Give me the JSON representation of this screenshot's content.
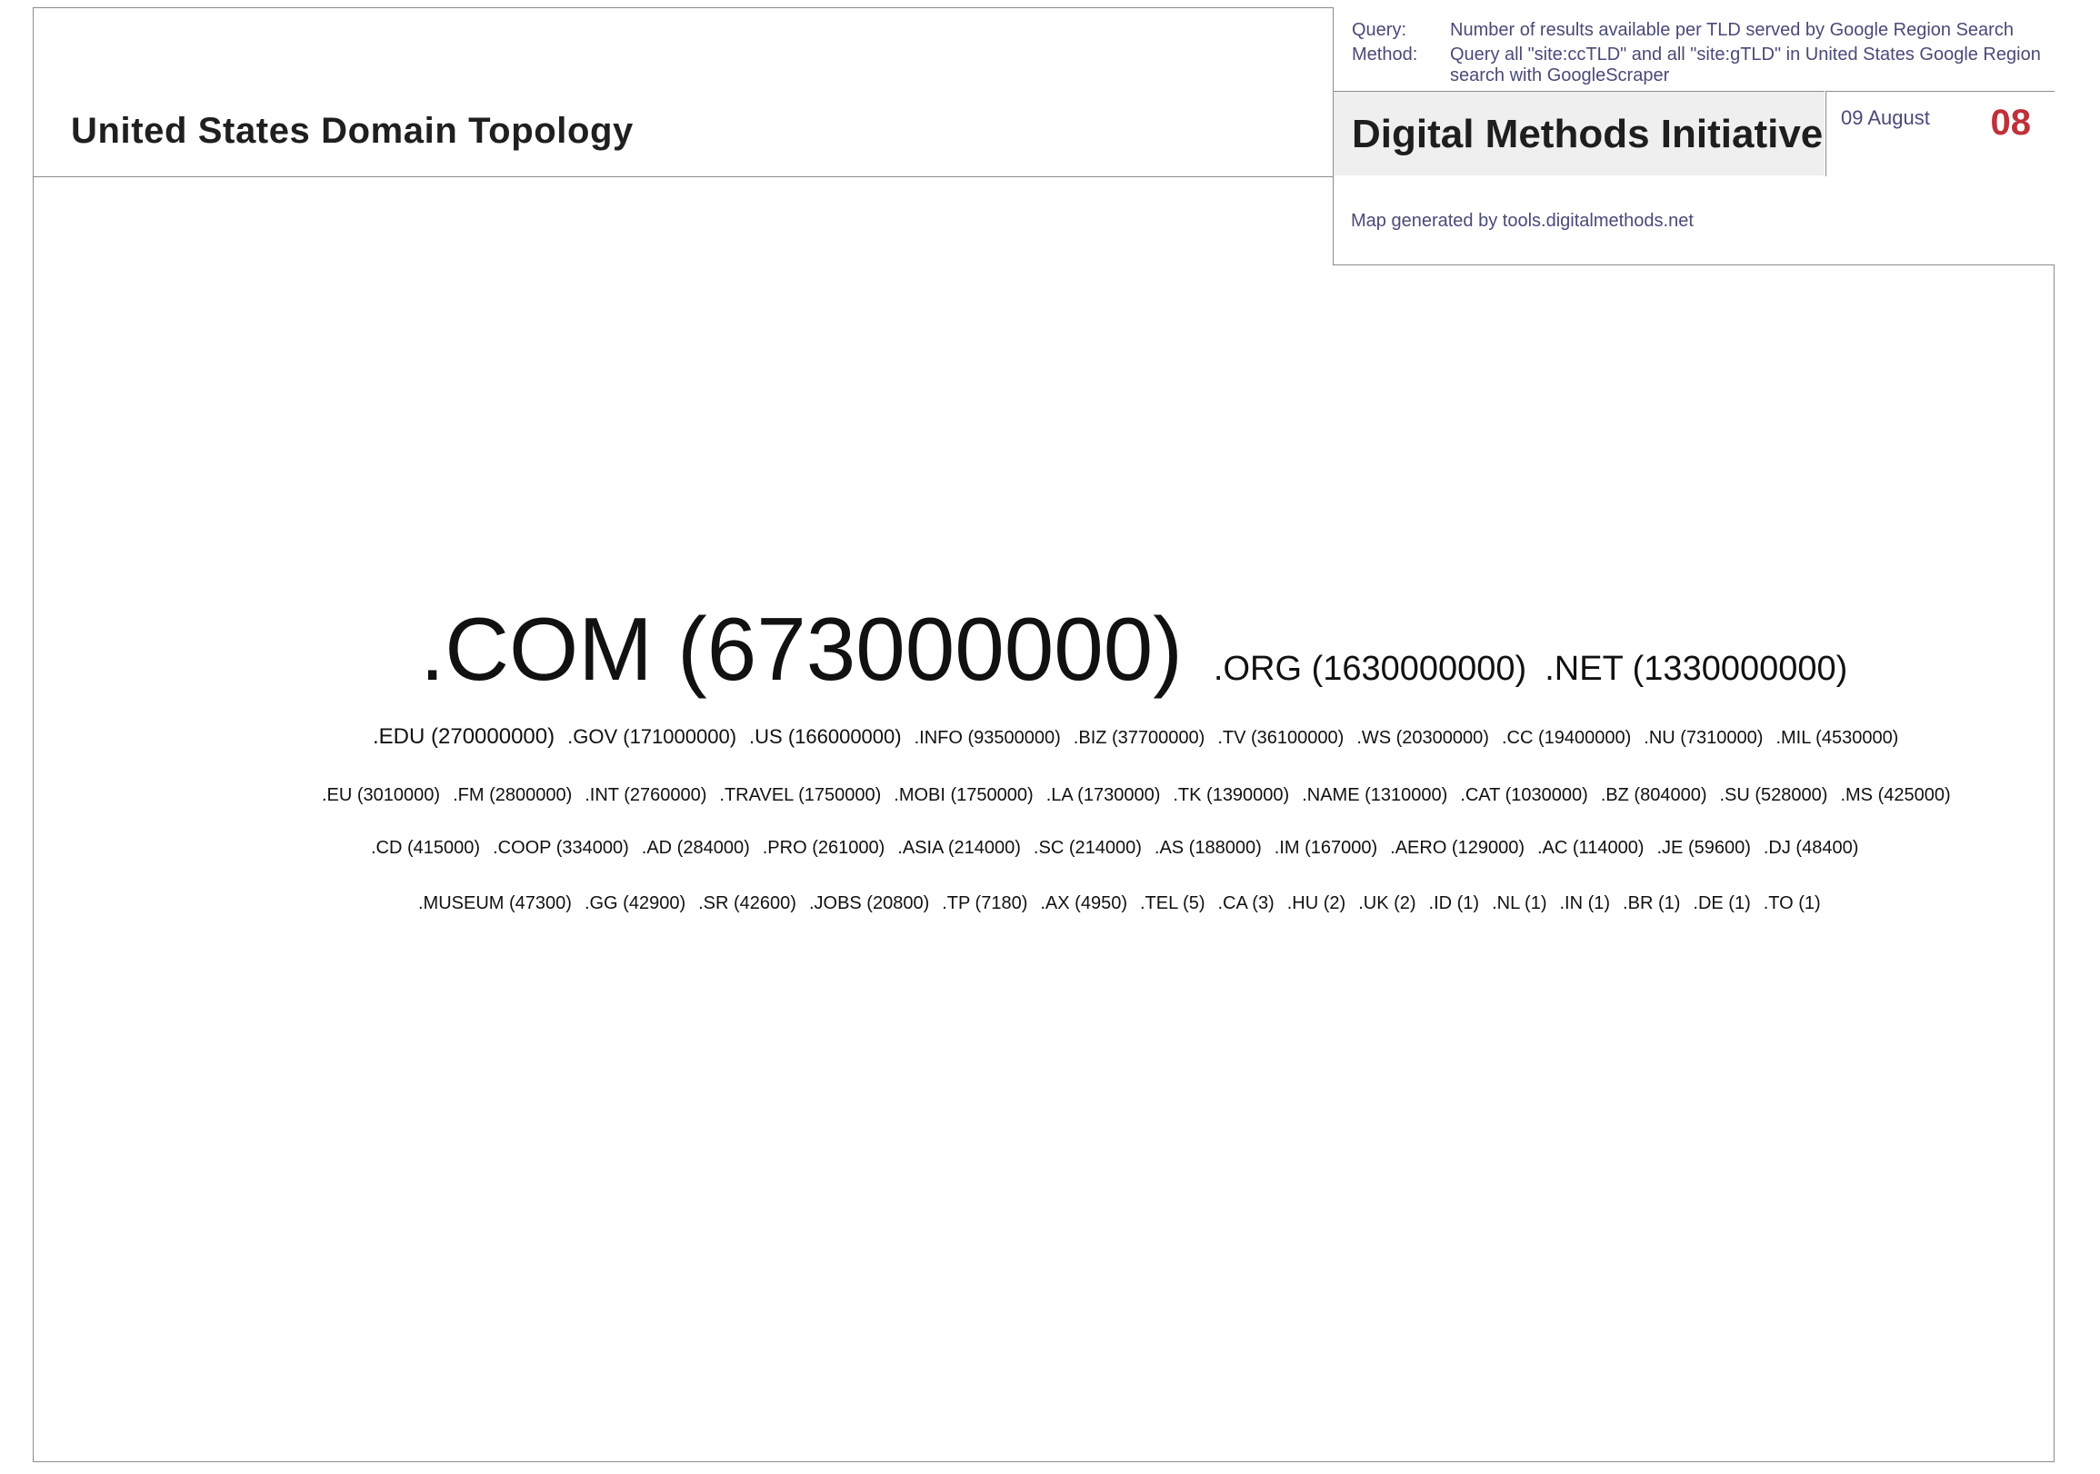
{
  "header": {
    "title": "United States Domain Topology"
  },
  "info": {
    "query_label": "Query:",
    "query_value": "Number of results available per TLD served by Google Region Search",
    "method_label": "Method:",
    "method_value": "Query all \"site:ccTLD\" and all \"site:gTLD\" in United States Google Region search with GoogleScraper",
    "organization": "Digital Methods Initiative",
    "date": "09 August",
    "year": "08",
    "credit": "Map generated by tools.digitalmethods.net"
  },
  "colors": {
    "accent": "#c0303a",
    "info_text": "#4a4a78",
    "border": "#8c8c8c",
    "panel_bg": "#efefef"
  },
  "tag_cloud": {
    "lines": [
      {
        "items": [
          {
            "label": ".COM (673000000)",
            "size": 98
          },
          {
            "label": ".ORG (1630000000)",
            "size": 38
          },
          {
            "label": ".NET (1330000000)",
            "size": 38
          }
        ]
      },
      {
        "items": [
          {
            "label": ".EDU (270000000)",
            "size": 24
          },
          {
            "label": ".GOV (171000000)",
            "size": 22
          },
          {
            "label": ".US (166000000)",
            "size": 22
          },
          {
            "label": ".INFO (93500000)",
            "size": 20
          },
          {
            "label": ".BIZ (37700000)",
            "size": 20
          },
          {
            "label": ".TV (36100000)",
            "size": 20
          },
          {
            "label": ".WS (20300000)",
            "size": 20
          },
          {
            "label": ".CC (19400000)",
            "size": 20
          },
          {
            "label": ".NU (7310000)",
            "size": 20
          },
          {
            "label": ".MIL (4530000)",
            "size": 20
          }
        ]
      },
      {
        "items": [
          {
            "label": ".EU (3010000)",
            "size": 20
          },
          {
            "label": ".FM (2800000)",
            "size": 20
          },
          {
            "label": ".INT (2760000)",
            "size": 20
          },
          {
            "label": ".TRAVEL (1750000)",
            "size": 20
          },
          {
            "label": ".MOBI (1750000)",
            "size": 20
          },
          {
            "label": ".LA (1730000)",
            "size": 20
          },
          {
            "label": ".TK (1390000)",
            "size": 20
          },
          {
            "label": ".NAME (1310000)",
            "size": 20
          },
          {
            "label": ".CAT (1030000)",
            "size": 20
          },
          {
            "label": ".BZ (804000)",
            "size": 20
          },
          {
            "label": ".SU (528000)",
            "size": 20
          },
          {
            "label": ".MS (425000)",
            "size": 20
          }
        ]
      },
      {
        "items": [
          {
            "label": ".CD (415000)",
            "size": 20
          },
          {
            "label": ".COOP (334000)",
            "size": 20
          },
          {
            "label": ".AD (284000)",
            "size": 20
          },
          {
            "label": ".PRO (261000)",
            "size": 20
          },
          {
            "label": ".ASIA (214000)",
            "size": 20
          },
          {
            "label": ".SC (214000)",
            "size": 20
          },
          {
            "label": ".AS (188000)",
            "size": 20
          },
          {
            "label": ".IM (167000)",
            "size": 20
          },
          {
            "label": ".AERO (129000)",
            "size": 20
          },
          {
            "label": ".AC (114000)",
            "size": 20
          },
          {
            "label": ".JE (59600)",
            "size": 20
          },
          {
            "label": ".DJ (48400)",
            "size": 20
          }
        ]
      },
      {
        "items": [
          {
            "label": ".MUSEUM (47300)",
            "size": 20
          },
          {
            "label": ".GG (42900)",
            "size": 20
          },
          {
            "label": ".SR (42600)",
            "size": 20
          },
          {
            "label": ".JOBS (20800)",
            "size": 20
          },
          {
            "label": ".TP (7180)",
            "size": 20
          },
          {
            "label": ".AX (4950)",
            "size": 20
          },
          {
            "label": ".TEL (5)",
            "size": 20
          },
          {
            "label": ".CA (3)",
            "size": 20
          },
          {
            "label": ".HU (2)",
            "size": 20
          },
          {
            "label": ".UK (2)",
            "size": 20
          },
          {
            "label": ".ID (1)",
            "size": 20
          },
          {
            "label": ".NL (1)",
            "size": 20
          },
          {
            "label": ".IN (1)",
            "size": 20
          },
          {
            "label": ".BR (1)",
            "size": 20
          },
          {
            "label": ".DE (1)",
            "size": 20
          },
          {
            "label": ".TO (1)",
            "size": 20
          }
        ]
      }
    ]
  }
}
